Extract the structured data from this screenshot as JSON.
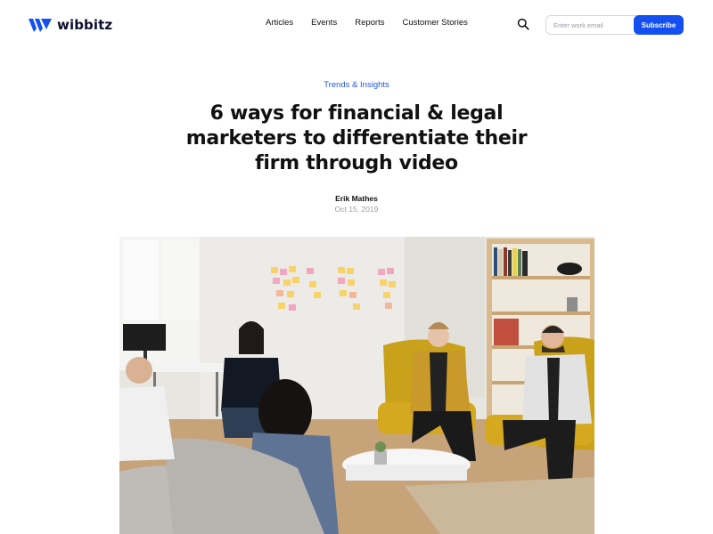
{
  "brand": {
    "name": "wibbitz",
    "accent": "#1450f0"
  },
  "nav": {
    "items": [
      {
        "label": "Articles"
      },
      {
        "label": "Events"
      },
      {
        "label": "Reports"
      },
      {
        "label": "Customer Stories"
      }
    ]
  },
  "header": {
    "search_icon": "search-icon",
    "email_placeholder": "Enter work email",
    "email_value": "",
    "subscribe_label": "Subscribe"
  },
  "article": {
    "category": "Trends & Insights",
    "title": "6 ways for financial & legal marketers to differentiate their firm through video",
    "author": "Erik Mathes",
    "date": "Oct 15, 2019",
    "hero_image": "office meeting photo"
  }
}
